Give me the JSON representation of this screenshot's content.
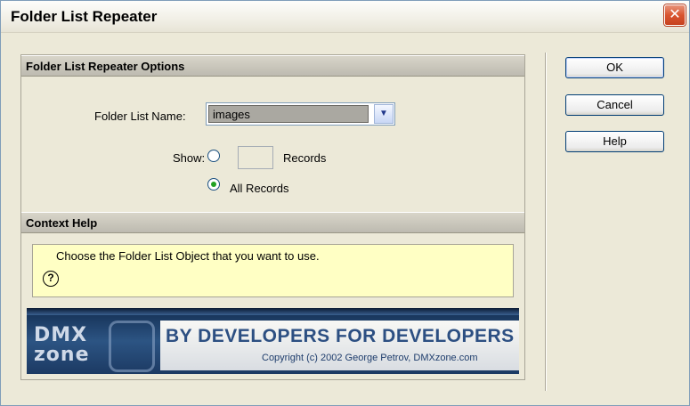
{
  "window": {
    "title": "Folder List Repeater",
    "close_glyph": "✕"
  },
  "options": {
    "header": "Folder List Repeater Options",
    "folder_list_label": "Folder List Name:",
    "folder_list_value": "images",
    "show_label": "Show:",
    "records_label": "Records",
    "records_value": "",
    "all_records_label": "All Records",
    "selected_show_option": "All Records"
  },
  "context_help": {
    "header": "Context Help",
    "icon": "?",
    "text": "Choose the Folder List Object that you want to use."
  },
  "banner": {
    "logo_line1": "DMX",
    "logo_line2": "zone",
    "tagline": "BY DEVELOPERS FOR DEVELOPERS",
    "copyright": "Copyright (c) 2002 George Petrov, DMXzone.com"
  },
  "buttons": {
    "ok": "OK",
    "cancel": "Cancel",
    "help": "Help"
  },
  "icons": {
    "dropdown": "chevron-down-icon",
    "help": "question-circle-icon",
    "close": "close-icon"
  },
  "colors": {
    "help_bg": "#ffffc4",
    "close_red": "#d9542f",
    "banner_navy": "#2c5483"
  }
}
